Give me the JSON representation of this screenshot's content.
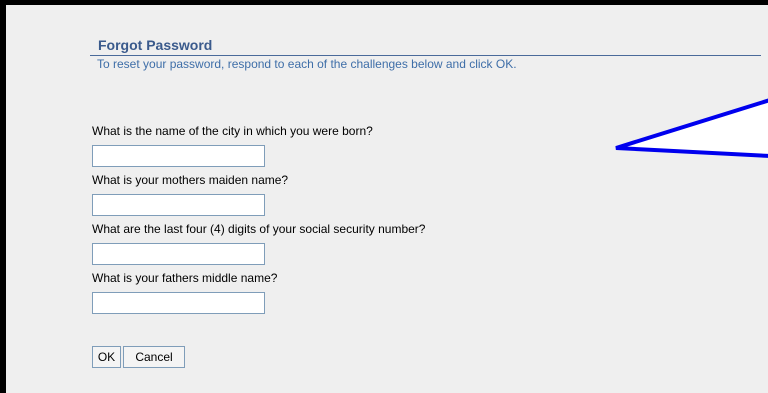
{
  "form": {
    "title": "Forgot Password",
    "instructions": "To reset your password, respond to each of the challenges below and click OK.",
    "questions": [
      {
        "label": "What is the name of the city in which you were born?",
        "value": ""
      },
      {
        "label": "What is your mothers maiden name?",
        "value": ""
      },
      {
        "label": "What are the last four (4) digits of your social security number?",
        "value": ""
      },
      {
        "label": "What is your fathers middle name?",
        "value": ""
      }
    ],
    "ok_label": "OK",
    "cancel_label": "Cancel"
  },
  "callout": {
    "fill_color": "#ffffff",
    "stroke_color": "#0000ee"
  }
}
